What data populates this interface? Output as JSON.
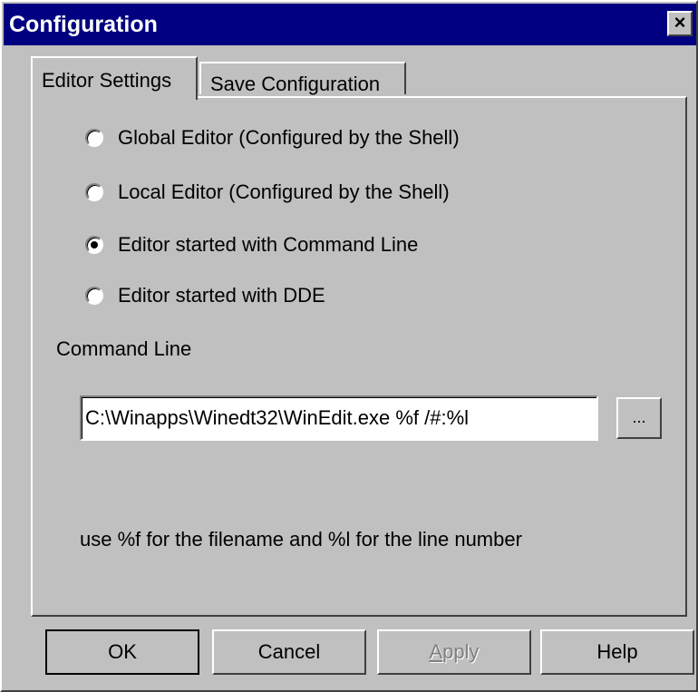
{
  "window": {
    "title": "Configuration",
    "close_label": "×"
  },
  "tabs": [
    {
      "label": "Editor Settings",
      "selected": true
    },
    {
      "label": "Save Configuration",
      "selected": false
    }
  ],
  "editor_options": [
    {
      "label": "Global Editor (Configured by the Shell)",
      "checked": false
    },
    {
      "label": "Local Editor (Configured by the Shell)",
      "checked": false
    },
    {
      "label": "Editor started with Command Line",
      "checked": true
    },
    {
      "label": "Editor started with DDE",
      "checked": false
    }
  ],
  "command_line": {
    "label": "Command Line",
    "value": "C:\\Winapps\\Winedt32\\WinEdit.exe %f /#:%l",
    "browse_label": "..."
  },
  "hint": "use %f for the filename and %l for the line number",
  "buttons": {
    "ok": "OK",
    "cancel": "Cancel",
    "apply_first": "A",
    "apply_rest": "pply",
    "help": "Help"
  }
}
